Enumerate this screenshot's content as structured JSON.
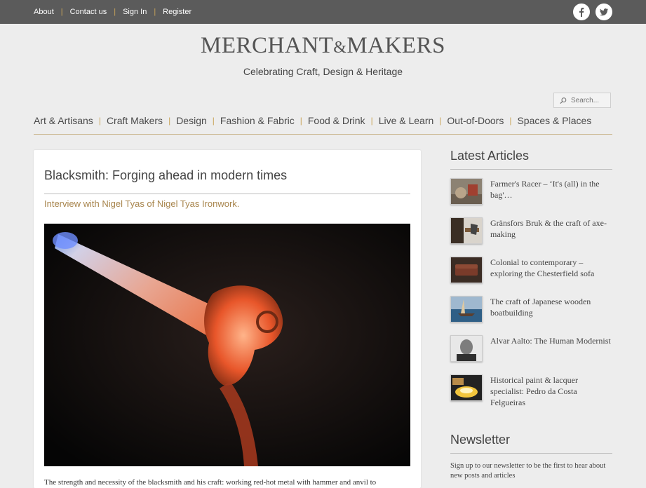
{
  "topbar": {
    "links": [
      "About",
      "Contact us",
      "Sign In",
      "Register"
    ],
    "social": [
      "facebook-icon",
      "twitter-icon"
    ],
    "background": "#5b5b5b",
    "separator_color": "#c9a55a"
  },
  "masthead": {
    "brand_left": "MERCHANT",
    "brand_amp": "&",
    "brand_right": "MAKERS",
    "tagline": "Celebrating Craft, Design & Heritage"
  },
  "search": {
    "placeholder": "Search..."
  },
  "nav": {
    "items": [
      "Art & Artisans",
      "Craft Makers",
      "Design",
      "Fashion & Fabric",
      "Food & Drink",
      "Live & Learn",
      "Out-of-Doors",
      "Spaces & Places"
    ]
  },
  "article": {
    "title": "Blacksmith: Forging ahead in modern times",
    "subtitle": "Interview with Nigel Tyas of Nigel Tyas Ironwork.",
    "body_start": "The strength and necessity of the blacksmith and his craft: working red-hot metal with hammer and anvil to",
    "accent_color": "#a8854d"
  },
  "sidebar": {
    "latest_title": "Latest Articles",
    "articles": [
      {
        "title": "Farmer's Racer – ‘It's (all) in the bag'…",
        "thumb": "racer-thumb"
      },
      {
        "title": "Gränsfors Bruk & the craft of axe-making",
        "thumb": "axe-thumb"
      },
      {
        "title": "Colonial to contemporary – exploring the Chesterfield sofa",
        "thumb": "sofa-thumb"
      },
      {
        "title": "The craft of Japanese wooden boatbuilding",
        "thumb": "boat-thumb"
      },
      {
        "title": "Alvar Aalto: The Human Modernist",
        "thumb": "portrait-thumb"
      },
      {
        "title": "Historical paint & lacquer specialist: Pedro da Costa Felgueiras",
        "thumb": "lacquer-thumb"
      }
    ],
    "newsletter_title": "Newsletter",
    "newsletter_text": "Sign up to our newsletter to be the first to hear about new posts and articles"
  }
}
